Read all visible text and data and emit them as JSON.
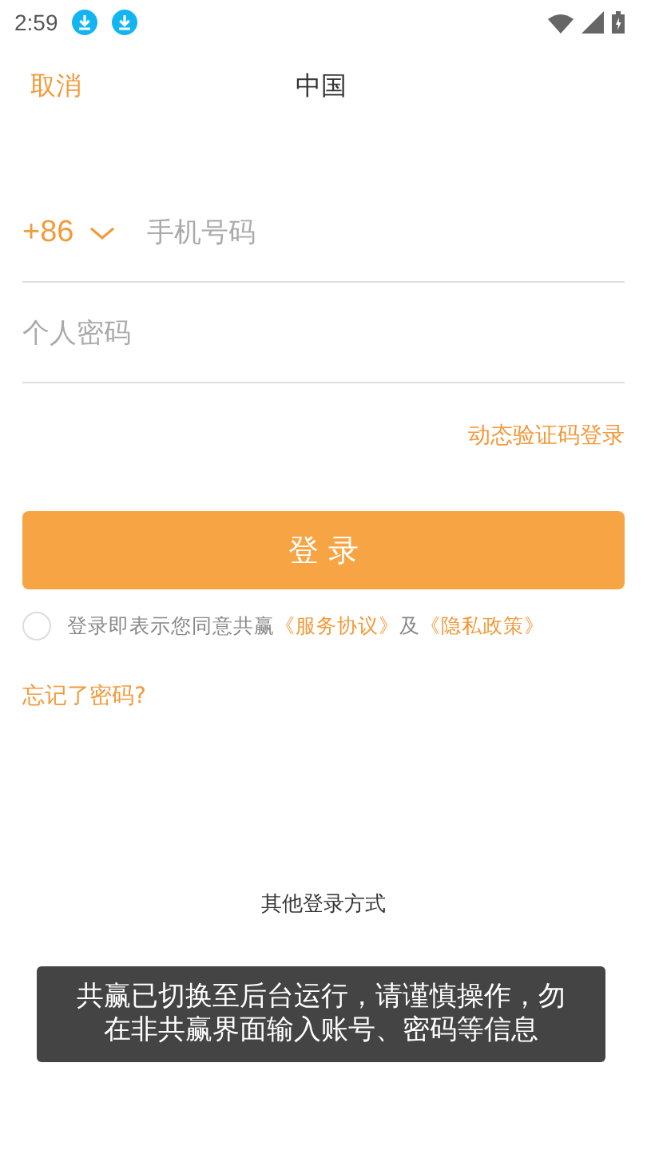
{
  "status_bar": {
    "time": "2:59",
    "notifications": [
      {
        "kind": "download"
      },
      {
        "kind": "download"
      }
    ]
  },
  "header": {
    "cancel": "取消",
    "region": "中国"
  },
  "phone_field": {
    "country_code": "+86",
    "placeholder": "手机号码"
  },
  "password_field": {
    "placeholder": "个人密码"
  },
  "sms_login_link": "动态验证码登录",
  "login_button": "登 录",
  "agreement": {
    "checked": false,
    "text": "登录即表示您同意共赢",
    "terms": "《服务协议》",
    "joiner": "及",
    "privacy": "《隐私政策》"
  },
  "forgot_password": "忘记了密码?",
  "other_login_label": "其他登录方式",
  "toast": "共赢已切换至后台运行，请谨慎操作，勿在非共赢界面输入账号、密码等信息"
}
